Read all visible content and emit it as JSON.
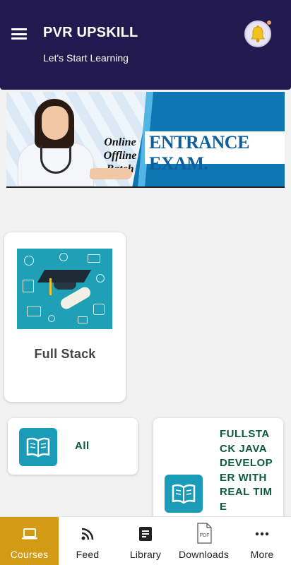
{
  "header": {
    "title": "PVR UPSKILL",
    "subtitle": "Let's Start Learning",
    "menu_icon": "hamburger-menu-icon",
    "notification_icon": "bell-icon"
  },
  "banner": {
    "batch_line1": "Online",
    "batch_line2": "Offline",
    "batch_line3": "Batch",
    "headline": "ENTRANCE EXAM."
  },
  "courses": [
    {
      "title": "Full Stack",
      "image": "graduation-cap-illustration"
    }
  ],
  "categories": [
    {
      "label": "All",
      "icon": "book-icon"
    },
    {
      "label": "FULLSTACK JAVA DEVELOPER WITH REAL TIME",
      "icon": "book-icon"
    }
  ],
  "bottom_nav": {
    "items": [
      {
        "label": "Courses",
        "icon": "laptop-icon",
        "active": true
      },
      {
        "label": "Feed",
        "icon": "rss-feed-icon",
        "active": false
      },
      {
        "label": "Library",
        "icon": "library-icon",
        "active": false
      },
      {
        "label": "Downloads",
        "icon": "pdf-download-icon",
        "active": false
      },
      {
        "label": "More",
        "icon": "more-dots-icon",
        "active": false
      }
    ]
  },
  "colors": {
    "header_bg": "#221a4e",
    "nav_active_bg": "#d39a14",
    "category_icon_bg": "#1a9cb8",
    "category_text": "#0d5a3a"
  }
}
